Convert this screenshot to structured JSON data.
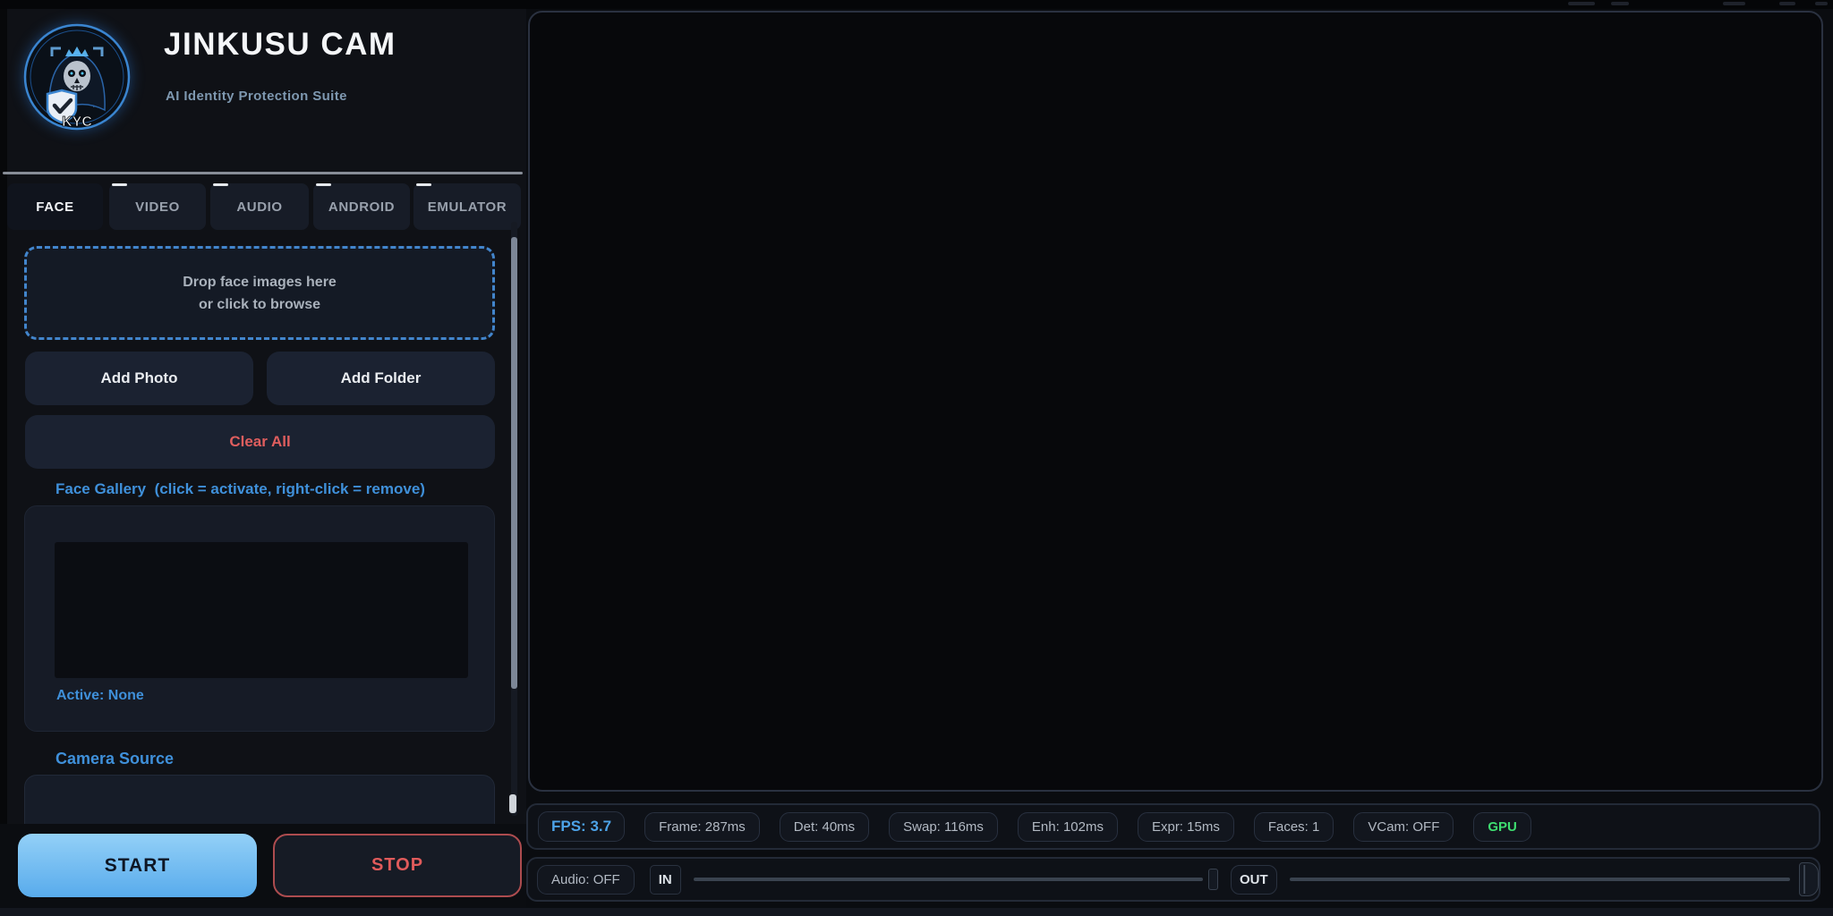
{
  "header": {
    "title": "JINKUSU CAM",
    "subtitle": "AI Identity Protection Suite",
    "logo_badge": "KYC"
  },
  "tabs": [
    {
      "label": "FACE",
      "active": true
    },
    {
      "label": "VIDEO",
      "active": false
    },
    {
      "label": "AUDIO",
      "active": false
    },
    {
      "label": "ANDROID",
      "active": false
    },
    {
      "label": "EMULATOR",
      "active": false
    }
  ],
  "face_tab": {
    "dropzone": {
      "line1": "Drop face images here",
      "line2": "or click to browse"
    },
    "buttons": {
      "add_photo": "Add Photo",
      "add_folder": "Add Folder",
      "clear_all": "Clear All"
    },
    "gallery": {
      "label": "Face Gallery  (click = activate, right-click = remove)",
      "active_status": "Active: None"
    },
    "camera_source_label": "Camera Source"
  },
  "controls": {
    "start": "START",
    "stop": "STOP"
  },
  "status_bar": {
    "pills": [
      "FPS: 3.7",
      "Frame: 287ms",
      "Det: 40ms",
      "Swap: 116ms",
      "Enh: 102ms",
      "Expr: 15ms",
      "Faces: 1",
      "VCam: OFF",
      "GPU"
    ]
  },
  "audio_bar": {
    "audio_toggle": "Audio: OFF",
    "in_label": "IN",
    "out_label": "OUT"
  },
  "colors": {
    "accent_blue": "#4da3e8",
    "label_blue": "#3f90da",
    "danger_red": "#e25d5d",
    "success_green": "#3edd70",
    "dropzone_border": "#4285cc",
    "start_gradient_top": "#93d0f7",
    "start_gradient_bottom": "#58abec"
  }
}
